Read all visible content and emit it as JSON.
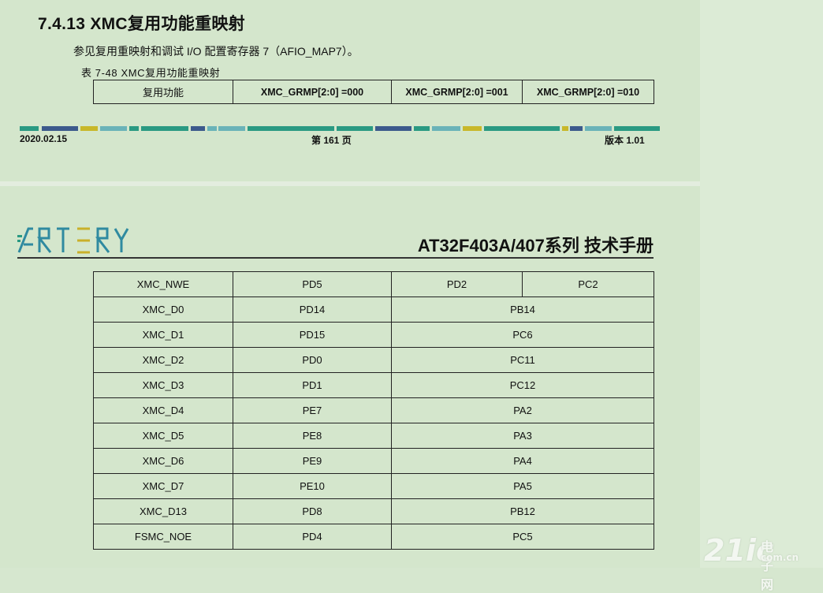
{
  "section": {
    "title": "7.4.13 XMC复用功能重映射",
    "paragraph": "参见复用重映射和调试 I/O 配置寄存器 7（AFIO_MAP7）。",
    "table_caption": "表   7-48 XMC复用功能重映射"
  },
  "header_table": {
    "cols": [
      "复用功能",
      "XMC_GRMP[2:0] =000",
      "XMC_GRMP[2:0]     =001",
      "XMC_GRMP[2:0]     =010"
    ]
  },
  "footer": {
    "date": "2020.02.15",
    "page": "第  161  页",
    "version": "版本  1.01",
    "bar_colors": [
      "#2a9a82",
      "#3c5a8c",
      "#c8b82a",
      "#6ab3b8",
      "#2a9a82",
      "#3c5a8c"
    ]
  },
  "header2": {
    "logo_text": "ARTERY",
    "doc_title": "AT32F403A/407系列  技术手册"
  },
  "pin_table": {
    "rows": [
      [
        "XMC_NWE",
        "PD5",
        "PD2",
        "PC2"
      ],
      [
        "XMC_D0",
        "PD14",
        "PB14"
      ],
      [
        "XMC_D1",
        "PD15",
        "PC6"
      ],
      [
        "XMC_D2",
        "PD0",
        "PC11"
      ],
      [
        "XMC_D3",
        "PD1",
        "PC12"
      ],
      [
        "XMC_D4",
        "PE7",
        "PA2"
      ],
      [
        "XMC_D5",
        "PE8",
        "PA3"
      ],
      [
        "XMC_D6",
        "PE9",
        "PA4"
      ],
      [
        "XMC_D7",
        "PE10",
        "PA5"
      ],
      [
        "XMC_D13",
        "PD8",
        "PB12"
      ],
      [
        "FSMC_NOE",
        "PD4",
        "PC5"
      ]
    ]
  },
  "watermark": {
    "text": "21ic",
    "cn": "电子网",
    "domain": "com.cn"
  }
}
